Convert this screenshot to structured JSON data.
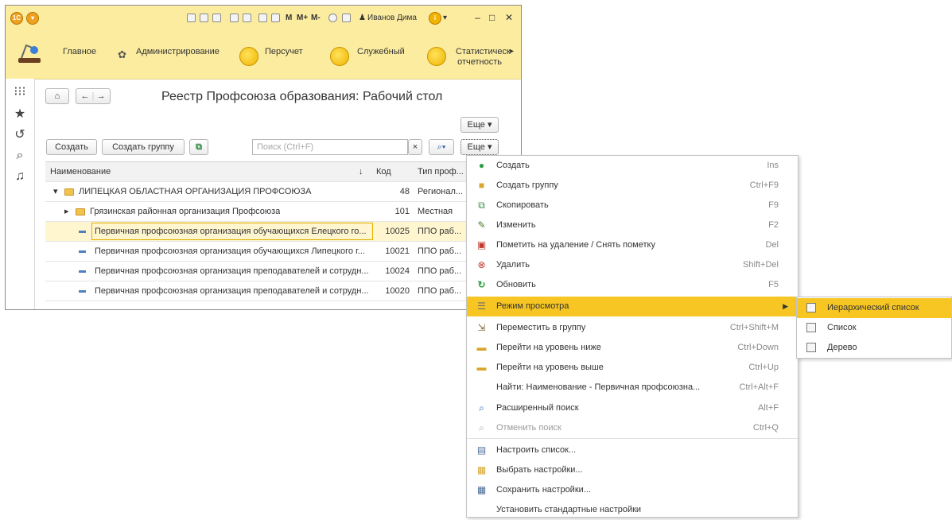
{
  "window": {
    "user": "Иванов Дима",
    "title_icons": [
      "save-icon",
      "print-icon",
      "preview-icon",
      "attach-icon",
      "print2-icon",
      "calc-icon",
      "calendar-icon"
    ],
    "memory_labels": [
      "M",
      "M+",
      "M-"
    ]
  },
  "sections": [
    "Главное",
    "Администрирование",
    "Персучет",
    "Служебный",
    "Статистическ отчетность"
  ],
  "nav": {
    "back": "←",
    "forward": "→"
  },
  "page_title": "Реестр Профсоюза образования: Рабочий стол",
  "toolbar": {
    "create": "Создать",
    "create_group": "Создать группу",
    "search_placeholder": "Поиск (Ctrl+F)",
    "more": "Еще ▾",
    "more_top": "Еще ▾"
  },
  "table": {
    "headers": {
      "name": "Наименование",
      "sort": "↓",
      "code": "Код",
      "type": "Тип проф..."
    },
    "rows": [
      {
        "name": "ЛИПЕЦКАЯ ОБЛАСТНАЯ ОРГАНИЗАЦИЯ ПРОФСОЮЗА",
        "code": "48",
        "type": "Регионал..."
      },
      {
        "name": "Грязинская районная организация Профсоюза",
        "code": "101",
        "type": "Местная"
      },
      {
        "name": "Первичная профсоюзная организация обучающихся Елецкого го...",
        "code": "10025",
        "type": "ППО раб..."
      },
      {
        "name": "Первичная профсоюзная организация обучающихся Липецкого г...",
        "code": "10021",
        "type": "ППО раб..."
      },
      {
        "name": "Первичная профсоюзная организация преподавателей и сотрудн...",
        "code": "10024",
        "type": "ППО раб..."
      },
      {
        "name": "Первичная профсоюзная организация преподавателей и сотрудн...",
        "code": "10020",
        "type": "ППО раб..."
      }
    ]
  },
  "menu": [
    {
      "label": "Создать",
      "shortcut": "Ins"
    },
    {
      "label": "Создать группу",
      "shortcut": "Ctrl+F9"
    },
    {
      "label": "Скопировать",
      "shortcut": "F9"
    },
    {
      "label": "Изменить",
      "shortcut": "F2"
    },
    {
      "label": "Пометить на удаление / Снять пометку",
      "shortcut": "Del"
    },
    {
      "label": "Удалить",
      "shortcut": "Shift+Del"
    },
    {
      "label": "Обновить",
      "shortcut": "F5"
    },
    {
      "label": "Режим просмотра",
      "shortcut": ""
    },
    {
      "label": "Переместить в группу",
      "shortcut": "Ctrl+Shift+M"
    },
    {
      "label": "Перейти на уровень ниже",
      "shortcut": "Ctrl+Down"
    },
    {
      "label": "Перейти на уровень выше",
      "shortcut": "Ctrl+Up"
    },
    {
      "label": "Найти: Наименование - Первичная профсоюзна...",
      "shortcut": "Ctrl+Alt+F"
    },
    {
      "label": "Расширенный поиск",
      "shortcut": "Alt+F"
    },
    {
      "label": "Отменить поиск",
      "shortcut": "Ctrl+Q"
    },
    {
      "label": "Настроить список...",
      "shortcut": ""
    },
    {
      "label": "Выбрать настройки...",
      "shortcut": ""
    },
    {
      "label": "Сохранить настройки...",
      "shortcut": ""
    },
    {
      "label": "Установить стандартные настройки",
      "shortcut": ""
    }
  ],
  "submenu": [
    "Иерархический список",
    "Список",
    "Дерево"
  ],
  "colors": {
    "accent": "#f5c518",
    "header": "#fbeca0",
    "selection_row": "#fff6d0"
  }
}
